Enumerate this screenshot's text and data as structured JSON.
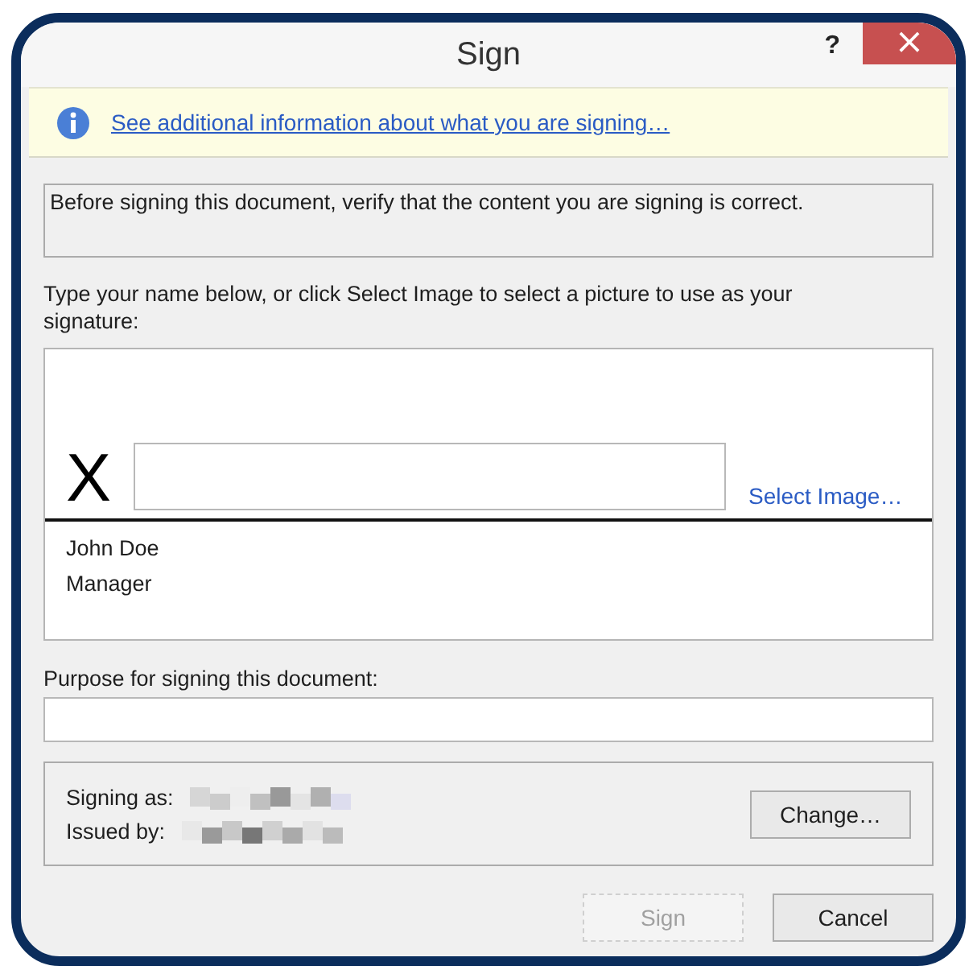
{
  "window": {
    "title": "Sign",
    "help": "?",
    "close": "×"
  },
  "info_bar": {
    "link": "See additional information about what you are signing…"
  },
  "notice": "Before signing this document, verify that the content you are signing is correct.",
  "signature": {
    "instruction": "Type your name below, or click Select Image to select a picture to use as your signature:",
    "mark": "X",
    "select_image": "Select Image…",
    "signer_name": "John Doe",
    "signer_title": "Manager"
  },
  "purpose": {
    "label": "Purpose for signing this document:"
  },
  "certificate": {
    "rows": [
      {
        "label": "Signing as:"
      },
      {
        "label": "Issued by:"
      }
    ],
    "change_button": "Change…"
  },
  "buttons": [
    {
      "label": "Sign",
      "disabled": true
    },
    {
      "label": "Cancel",
      "disabled": false
    }
  ]
}
